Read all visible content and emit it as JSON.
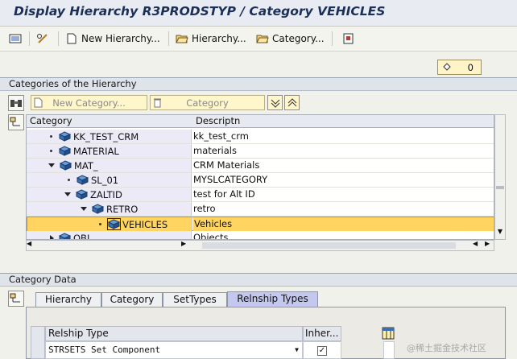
{
  "title": "Display Hierarchy R3PRODSTYP / Category VEHICLES",
  "toolbar": {
    "new_hierarchy": "New Hierarchy...",
    "hierarchy": "Hierarchy...",
    "category": "Category..."
  },
  "counter": {
    "value": "0"
  },
  "hierarchy_section": {
    "title": "Categories of the Hierarchy",
    "new_category_placeholder": "New Category...",
    "category_button": "Category",
    "columns": [
      "Category",
      "Descriptn"
    ],
    "rows": [
      {
        "category": "KK_TEST_CRM",
        "description": "kk_test_crm"
      },
      {
        "category": "MATERIAL",
        "description": "materials"
      },
      {
        "category": "MAT_",
        "description": "CRM Materials"
      },
      {
        "category": "SL_01",
        "description": "MYSLCATEGORY"
      },
      {
        "category": "ZALTID",
        "description": "test for Alt ID"
      },
      {
        "category": "RETRO",
        "description": "retro"
      },
      {
        "category": "VEHICLES",
        "description": "Vehicles"
      },
      {
        "category": "OBJ",
        "description": "Objects"
      }
    ]
  },
  "category_data": {
    "title": "Category Data",
    "tabs": [
      "Hierarchy",
      "Category",
      "SetTypes",
      "Relnship Types"
    ],
    "active_tab": "Relnship Types",
    "grid": {
      "columns": [
        "Relship Type",
        "Inher..."
      ],
      "rows": [
        {
          "type": "STRSETS Set Component",
          "inherited": true
        }
      ]
    }
  },
  "watermark": "@稀土掘金技术社区",
  "colors": {
    "selection": "#ffd460",
    "title": "#1c2f56",
    "input_bg": "#fff6cc"
  }
}
